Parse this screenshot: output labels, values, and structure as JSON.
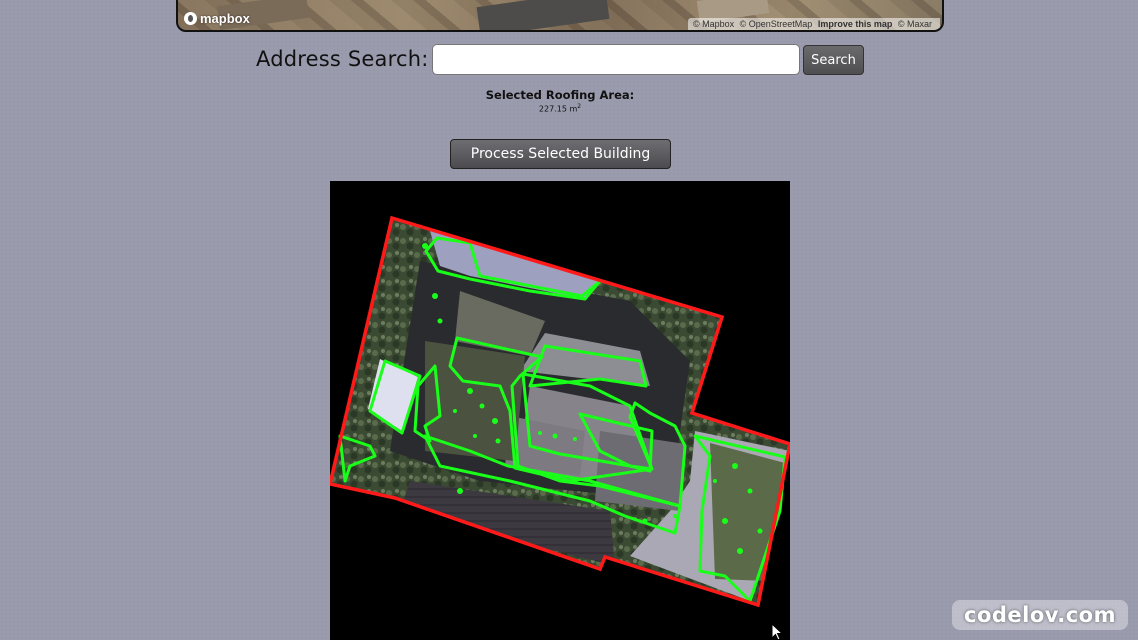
{
  "map": {
    "logo_text": "mapbox",
    "attribution": {
      "mapbox": "© Mapbox",
      "osm": "© OpenStreetMap",
      "improve": "Improve this map",
      "maxar": "© Maxar"
    }
  },
  "search": {
    "label": "Address Search:",
    "value": "",
    "placeholder": "",
    "button_label": "Search"
  },
  "area": {
    "title": "Selected Roofing Area:",
    "value": "227.15 m",
    "unit_exponent": "2"
  },
  "process_button_label": "Process Selected Building",
  "colors": {
    "page_background": "#9a9cae",
    "building_outline": "#ff1a1a",
    "segment_outline": "#19ff19",
    "button_background": "#5c5c60"
  },
  "watermark": "codelov.com"
}
